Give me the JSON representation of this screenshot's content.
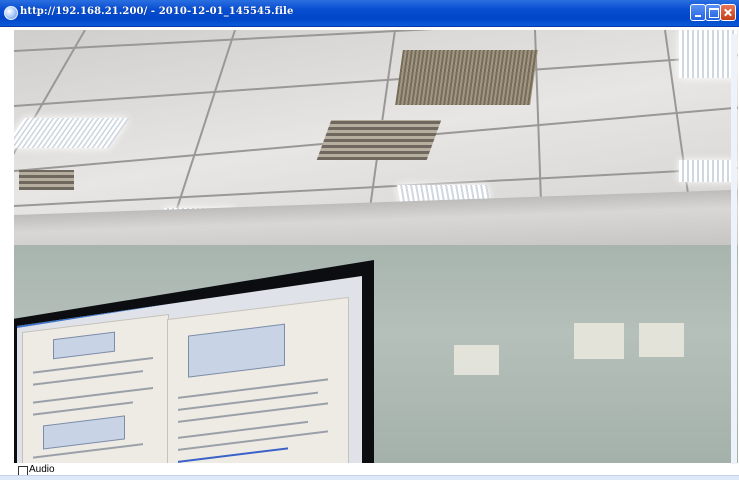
{
  "window": {
    "title": "http://192.168.21.200/ - 2010-12-01_145545.file",
    "app_icon": "browser-icon"
  },
  "titlebar_buttons": {
    "minimize_icon": "minimize-icon",
    "maximize_icon": "maximize-icon",
    "close_icon": "close-icon"
  },
  "video": {
    "audio_label": "Audio"
  },
  "colors": {
    "titlebar": "#0046c8",
    "close_button": "#c43d16",
    "background": "#ffffff"
  }
}
